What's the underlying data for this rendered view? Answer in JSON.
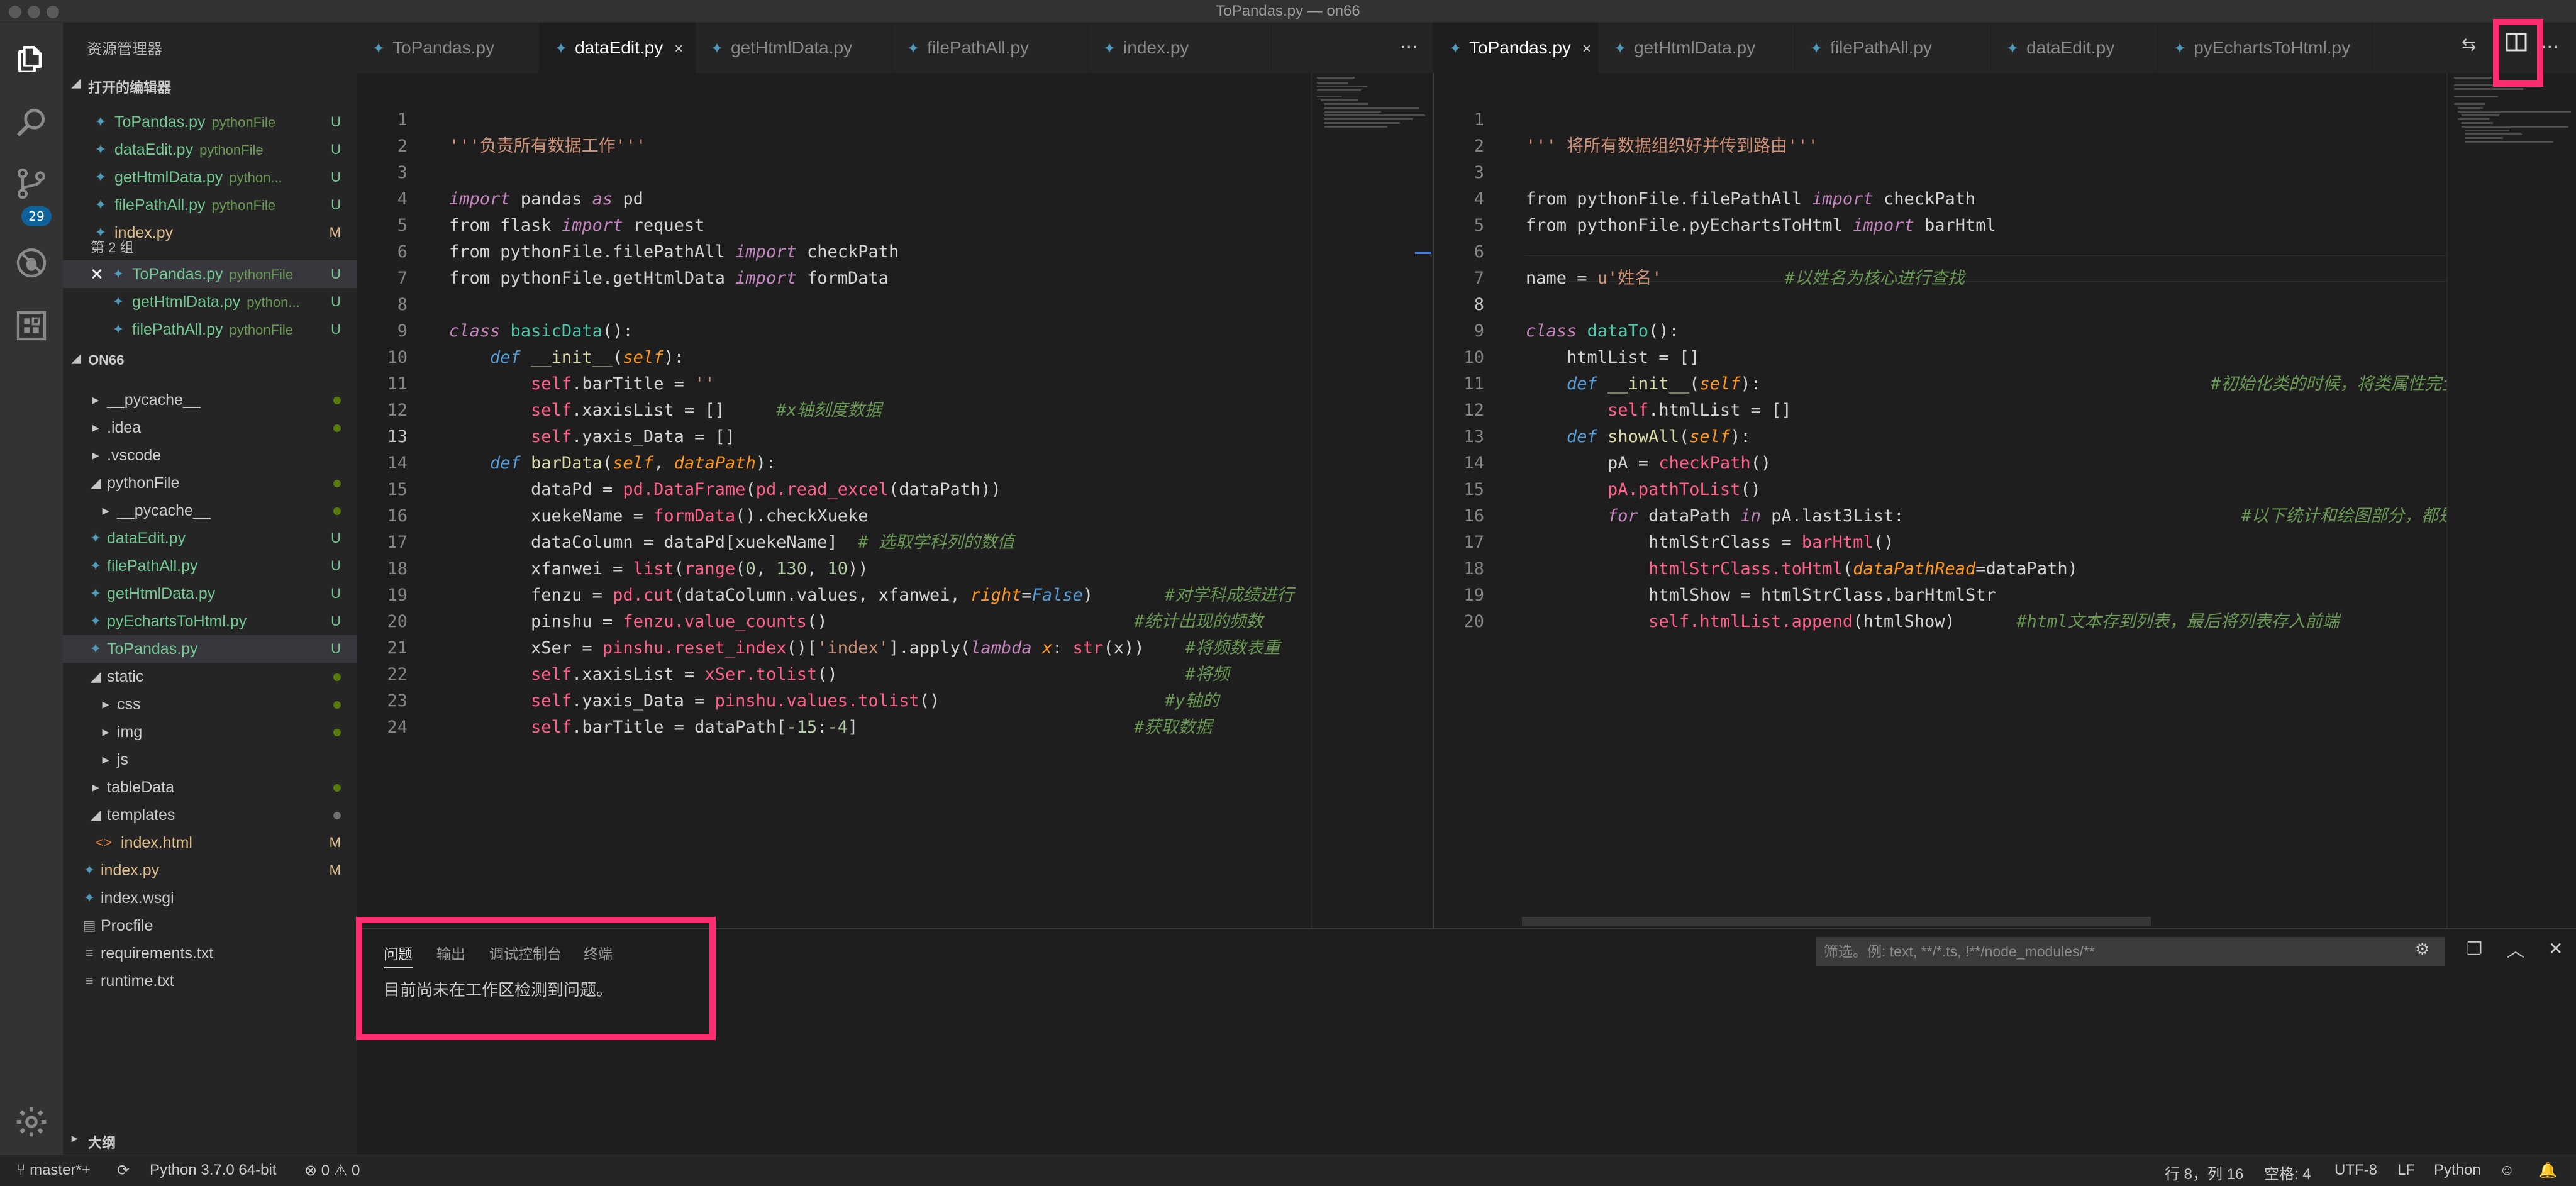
{
  "window": {
    "title": "ToPandas.py — on66"
  },
  "activity": {
    "scm_badge": "29"
  },
  "explorer": {
    "title": "资源管理器",
    "open_editors_label": "打开的编辑器",
    "group2_label": "第 2 组",
    "project_label": "ON66",
    "outline_label": "大纲",
    "open_group1": [
      {
        "name": "ToPandas.py",
        "sub": "pythonFile",
        "status": "U"
      },
      {
        "name": "dataEdit.py",
        "sub": "pythonFile",
        "status": "U"
      },
      {
        "name": "getHtmlData.py",
        "sub": "python...",
        "status": "U"
      },
      {
        "name": "filePathAll.py",
        "sub": "pythonFile",
        "status": "U"
      },
      {
        "name": "index.py",
        "sub": "",
        "status": "M"
      }
    ],
    "open_group2": [
      {
        "name": "ToPandas.py",
        "sub": "pythonFile",
        "status": "U"
      },
      {
        "name": "getHtmlData.py",
        "sub": "python...",
        "status": "U"
      },
      {
        "name": "filePathAll.py",
        "sub": "pythonFile",
        "status": "U"
      }
    ],
    "tree": [
      {
        "name": "__pycache__",
        "status": ""
      },
      {
        "name": ".idea",
        "status": ""
      },
      {
        "name": ".vscode",
        "status": ""
      },
      {
        "name": "pythonFile",
        "status": ""
      },
      {
        "name": "__pycache__",
        "status": ""
      },
      {
        "name": "dataEdit.py",
        "status": "U"
      },
      {
        "name": "filePathAll.py",
        "status": "U"
      },
      {
        "name": "getHtmlData.py",
        "status": "U"
      },
      {
        "name": "pyEchartsToHtml.py",
        "status": "U"
      },
      {
        "name": "ToPandas.py",
        "status": "U"
      },
      {
        "name": "static",
        "status": ""
      },
      {
        "name": "css",
        "status": ""
      },
      {
        "name": "img",
        "status": ""
      },
      {
        "name": "js",
        "status": ""
      },
      {
        "name": "tableData",
        "status": ""
      },
      {
        "name": "templates",
        "status": ""
      },
      {
        "name": "index.html",
        "status": "M"
      },
      {
        "name": "index.py",
        "status": "M"
      },
      {
        "name": "index.wsgi",
        "status": ""
      },
      {
        "name": "Procfile",
        "status": ""
      },
      {
        "name": "requirements.txt",
        "status": ""
      },
      {
        "name": "runtime.txt",
        "status": ""
      }
    ]
  },
  "left_tabs": [
    "ToPandas.py",
    "dataEdit.py",
    "getHtmlData.py",
    "filePathAll.py",
    "index.py"
  ],
  "right_tabs": [
    "ToPandas.py",
    "getHtmlData.py",
    "filePathAll.py",
    "dataEdit.py",
    "pyEchartsToHtml.py"
  ],
  "tab_close": "×",
  "more": "···",
  "left_line_numbers": [
    "1",
    "2",
    "3",
    "4",
    "5",
    "6",
    "7",
    "8",
    "9",
    "10",
    "11",
    "12",
    "13",
    "14",
    "15",
    "16",
    "17",
    "18",
    "19",
    "20",
    "21",
    "22",
    "23",
    "24"
  ],
  "right_line_numbers": [
    "1",
    "2",
    "3",
    "4",
    "5",
    "6",
    "7",
    "8",
    "9",
    "10",
    "11",
    "12",
    "13",
    "14",
    "15",
    "16",
    "17",
    "18",
    "19",
    "20"
  ],
  "panel": {
    "tabs": [
      "问题",
      "输出",
      "调试控制台",
      "终端"
    ],
    "message": "目前尚未在工作区检测到问题。",
    "filter_placeholder": "筛选。例: text, **/*.ts, !**/node_modules/**"
  },
  "status": {
    "branch": "master*+",
    "python": "Python 3.7.0 64-bit",
    "errors": "0",
    "warnings": "0",
    "position": "行 8，列 16",
    "spaces": "空格: 4",
    "encoding": "UTF-8",
    "eol": "LF",
    "language": "Python"
  },
  "colors": {
    "highlight": "#ff2d6f",
    "activity_bg": "#333333",
    "sidebar_bg": "#252526",
    "editor_bg": "#1e1e1e"
  }
}
